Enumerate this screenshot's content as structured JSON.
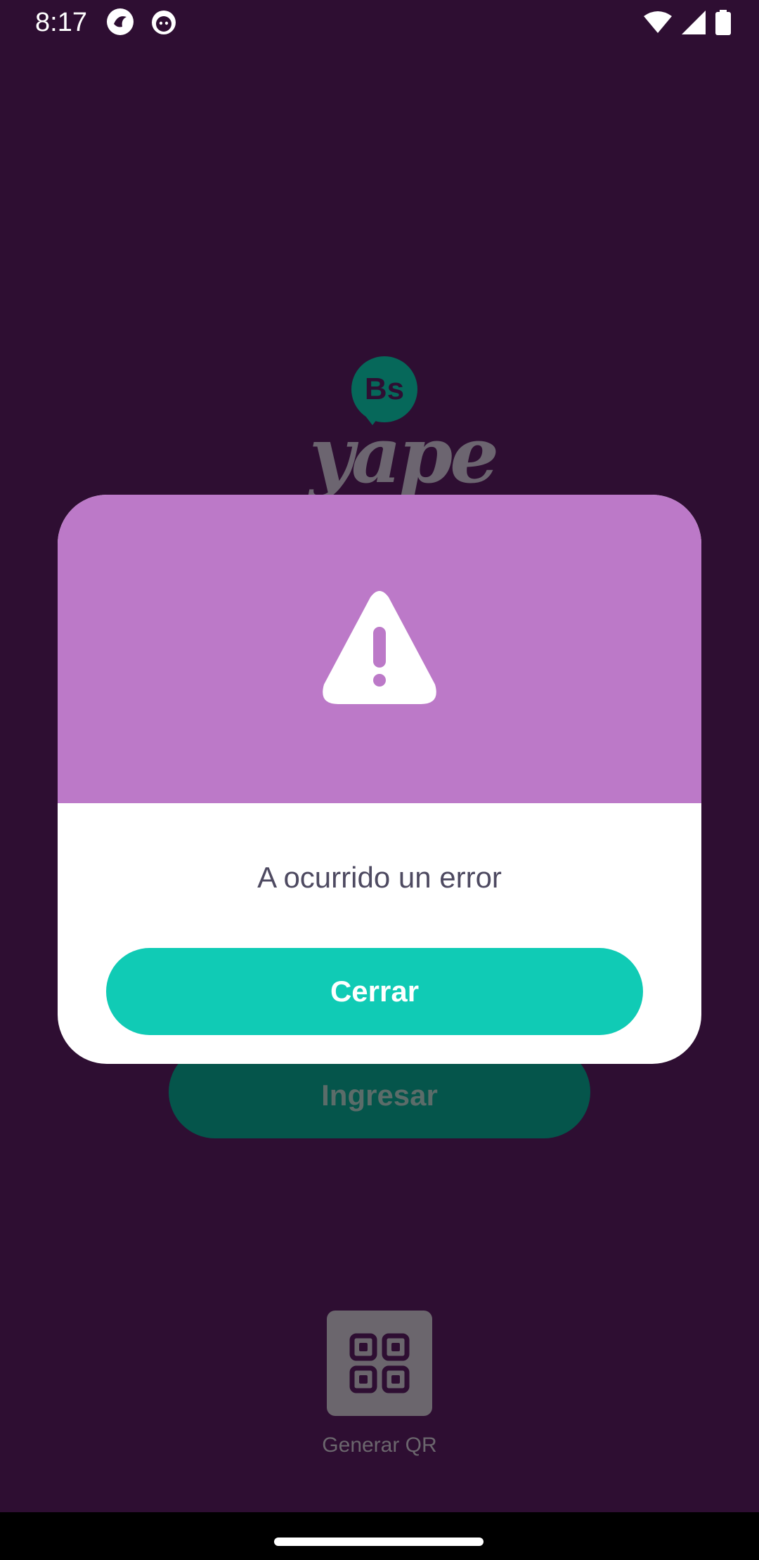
{
  "status_bar": {
    "time": "8:17",
    "icons": [
      "app-notification-icon",
      "cat-notification-icon",
      "wifi-icon",
      "signal-icon",
      "battery-icon"
    ]
  },
  "logo": {
    "badge_text": "Bs",
    "wordmark": "yape"
  },
  "login": {
    "ingresar_label": "Ingresar"
  },
  "qr": {
    "icon": "qr-grid-icon",
    "label": "Generar QR"
  },
  "dialog": {
    "icon": "warning-icon",
    "message": "A ocurrido un error",
    "close_label": "Cerrar",
    "header_color": "#bc79c8",
    "button_color": "#10cbb5"
  },
  "colors": {
    "background": "#2e0e32",
    "brand_green": "#06685a"
  }
}
